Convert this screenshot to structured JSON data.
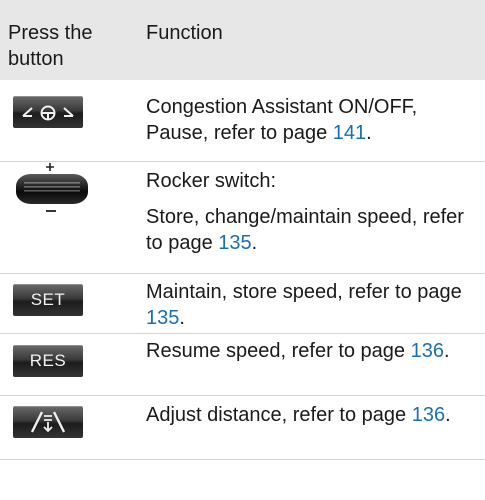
{
  "header": {
    "col1": "Press the button",
    "col2": "Function"
  },
  "rows": [
    {
      "icon": "congestion-assistant-icon",
      "text": "Congestion Assistant ON/OFF, Pause, refer to page ",
      "page": "141",
      "tail": "."
    },
    {
      "icon": "rocker-switch-icon",
      "title": "Rocker switch:",
      "text": "Store, change/maintain speed, refer to page ",
      "page": "135",
      "tail": "."
    },
    {
      "button_label": "SET",
      "text": "Maintain, store speed, refer to page ",
      "page": "135",
      "tail": "."
    },
    {
      "button_label": "RES",
      "text": "Resume speed, refer to page ",
      "page": "136",
      "tail": "."
    },
    {
      "icon": "distance-adjust-icon",
      "text": "Adjust distance, refer to page ",
      "page": "136",
      "tail": "."
    }
  ],
  "colors": {
    "header_bg": "#e7e7e7",
    "link": "#1b6fb3",
    "divider": "#d4d4d4"
  }
}
